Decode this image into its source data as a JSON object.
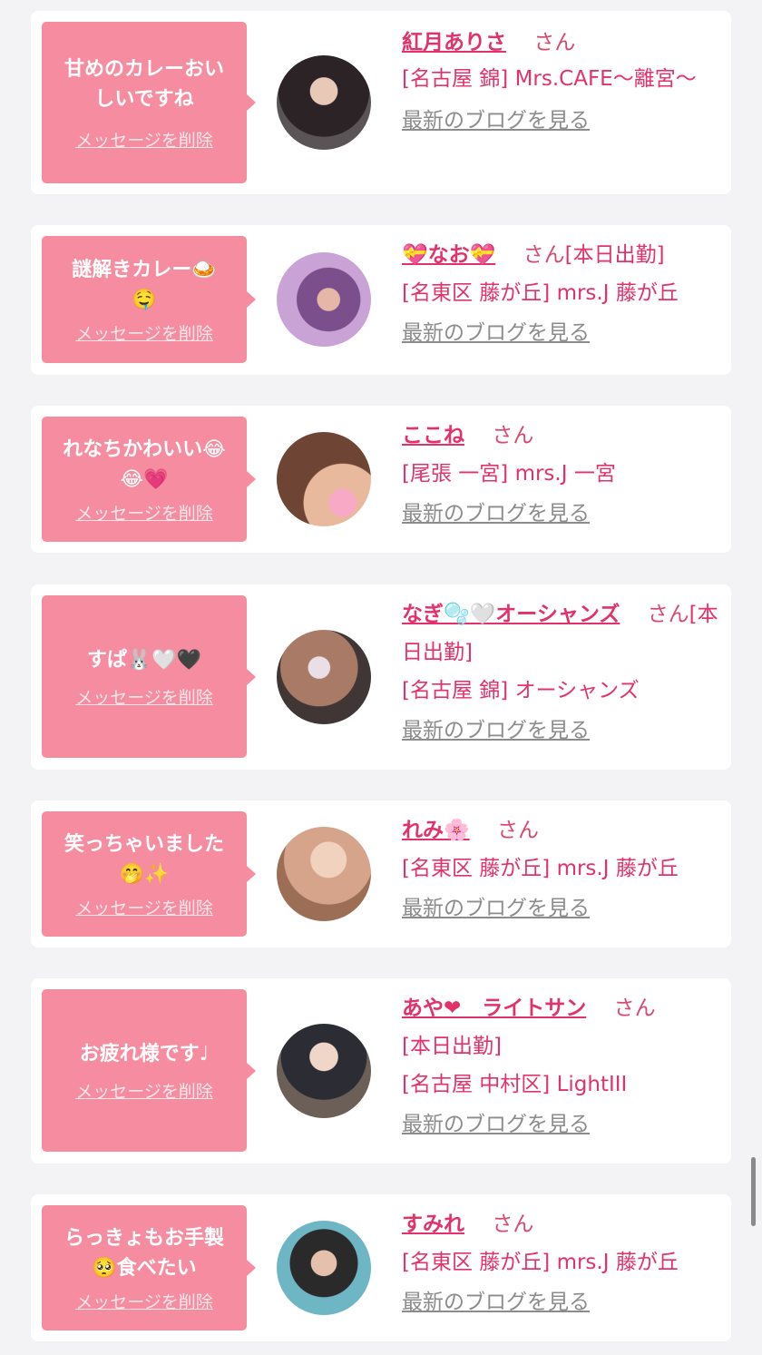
{
  "delete_label": "メッセージを削除",
  "blog_label": "最新のブログを見る",
  "san_label": "さん",
  "cards": [
    {
      "message": "甘めのカレーおい\nしいですね",
      "name": "紅月ありさ",
      "status": "",
      "shop": "[名古屋 錦] Mrs.CAFE〜離宮〜"
    },
    {
      "message": "謎解きカレー🍛\n🤤",
      "name": "💝なお💝",
      "status": "[本日出勤]",
      "shop": "[名東区 藤が丘] mrs.J 藤が丘"
    },
    {
      "message": "れなちかわいい😂\n😂💗",
      "name": "ここね",
      "status": "",
      "shop": "[尾張 一宮] mrs.J 一宮"
    },
    {
      "message": "すぱ🐰🤍🖤",
      "name": "なぎ🫧🤍オーシャンズ",
      "status": "[本日出勤]",
      "shop": "[名古屋 錦] オーシャンズ"
    },
    {
      "message": "笑っちゃいました\n🤭✨",
      "name": "れみ🌸",
      "status": "",
      "shop": "[名東区 藤が丘] mrs.J 藤が丘"
    },
    {
      "message": "お疲れ様です♩",
      "name": "あや❤︎　ライトサン",
      "status": "[本日出勤]",
      "shop": "[名古屋 中村区] LightIII"
    },
    {
      "message": "らっきょもお手製\n🥺食べたい",
      "name": "すみれ",
      "status": "",
      "shop": "[名東区 藤が丘] mrs.J 藤が丘"
    }
  ]
}
